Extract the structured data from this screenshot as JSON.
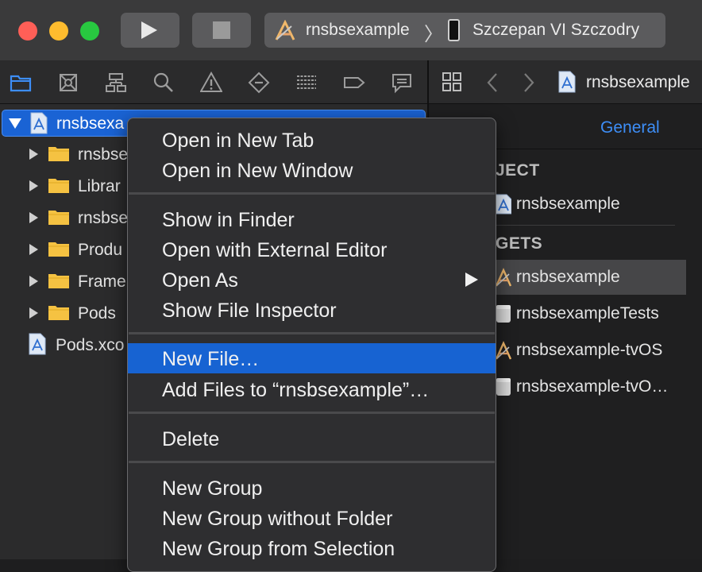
{
  "toolbar": {
    "scheme": "rnsbsexample",
    "separator": "〉",
    "device": "Szczepan VI Szczodry"
  },
  "navigator": {
    "tabs": [
      {
        "name": "project-navigator-icon",
        "active": true
      },
      {
        "name": "source-control-navigator-icon"
      },
      {
        "name": "symbol-navigator-icon"
      },
      {
        "name": "find-navigator-icon"
      },
      {
        "name": "issue-navigator-icon"
      },
      {
        "name": "test-navigator-icon"
      },
      {
        "name": "debug-navigator-icon"
      },
      {
        "name": "breakpoint-navigator-icon"
      },
      {
        "name": "report-navigator-icon"
      }
    ],
    "root": "rnsbsexa",
    "items": [
      {
        "label": "rnsbse",
        "icon": "folder-icon"
      },
      {
        "label": "Librar",
        "icon": "folder-icon"
      },
      {
        "label": "rnsbse",
        "icon": "folder-icon"
      },
      {
        "label": "Produ",
        "icon": "folder-icon"
      },
      {
        "label": "Frame",
        "icon": "folder-icon"
      },
      {
        "label": "Pods",
        "icon": "folder-icon"
      }
    ],
    "pods_project": "Pods.xco"
  },
  "editor": {
    "jump_bar_title": "rnsbsexample",
    "tab_general": "General",
    "project_section": "JECT",
    "project_item": "rnsbsexample",
    "targets_section": "GETS",
    "targets": [
      {
        "label": "rnsbsexample",
        "selected": true
      },
      {
        "label": "rnsbsexampleTests"
      },
      {
        "label": "rnsbsexample-tvOS"
      },
      {
        "label": "rnsbsexample-tvO…"
      }
    ]
  },
  "context_menu": {
    "groups": [
      [
        "Open in New Tab",
        "Open in New Window"
      ],
      [
        "Show in Finder",
        "Open with External Editor",
        "Open As",
        "Show File Inspector"
      ],
      [
        "New File…",
        "Add Files to “rnsbsexample”…"
      ],
      [
        "Delete"
      ],
      [
        "New Group",
        "New Group without Folder",
        "New Group from Selection"
      ]
    ],
    "highlighted": "New File…",
    "has_submenu": "Open As"
  },
  "colors": {
    "accent": "#1763d2",
    "link": "#3d8ef7",
    "folder": "#f5c242"
  }
}
